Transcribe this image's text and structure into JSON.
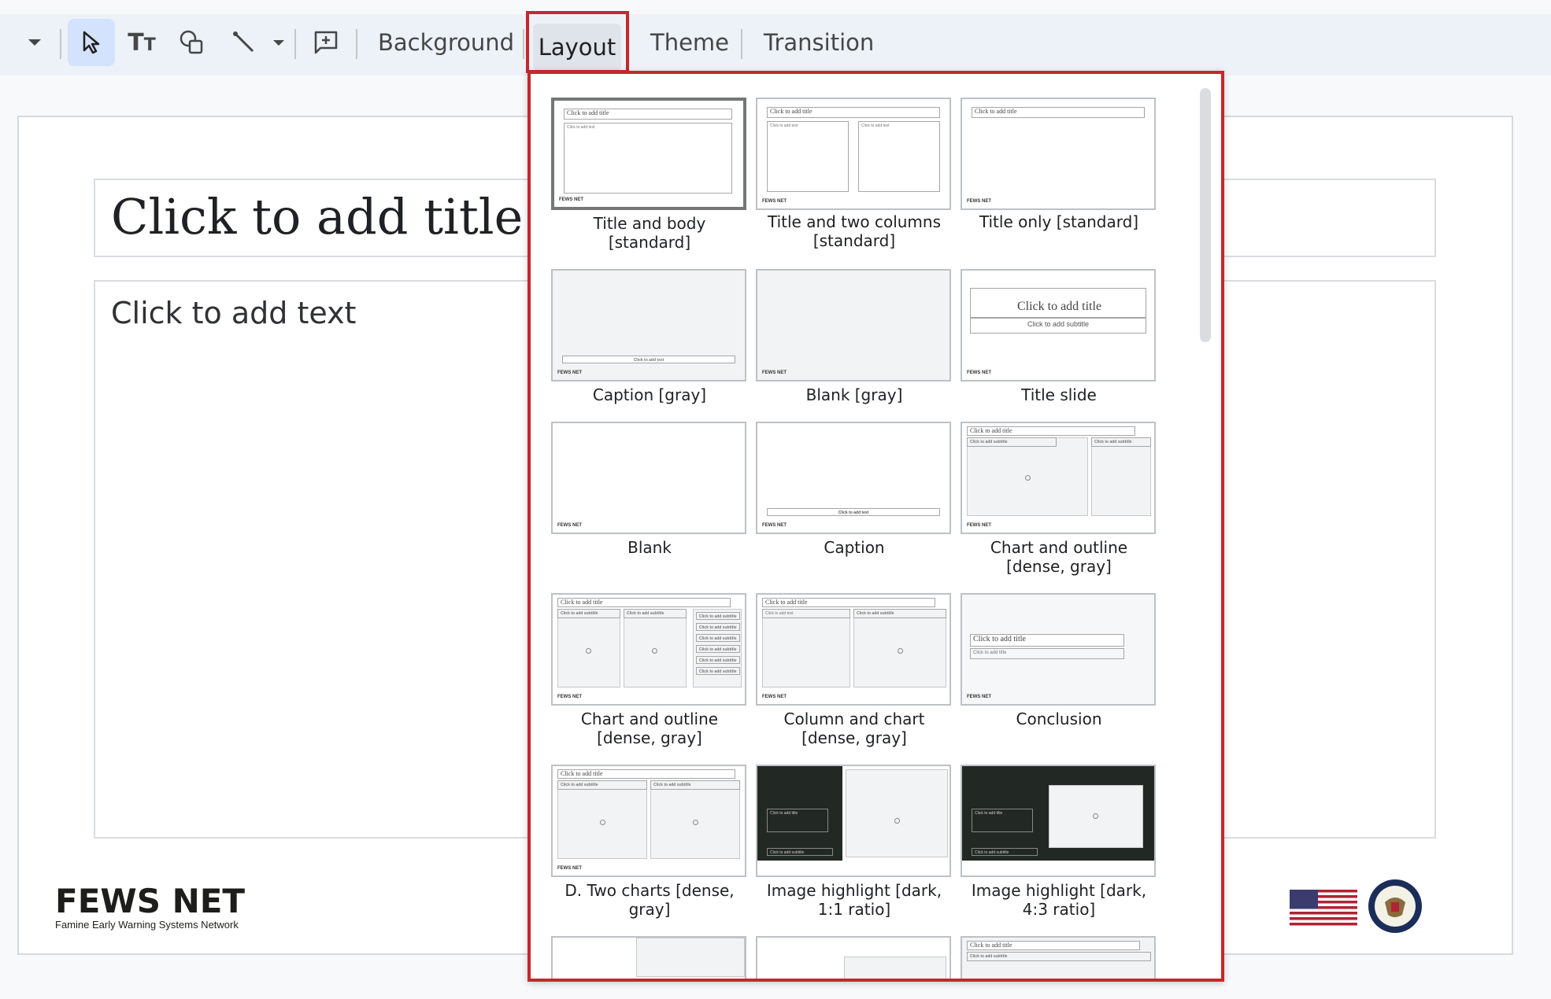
{
  "toolbar": {
    "background_label": "Background",
    "layout_label": "Layout",
    "theme_label": "Theme",
    "transition_label": "Transition"
  },
  "slide": {
    "title_placeholder": "Click to add title",
    "body_placeholder": "Click to add text",
    "logo_main": "FEWS NET",
    "logo_sub": "Famine Early Warning Systems Network"
  },
  "mini": {
    "title": "Click to add title",
    "text": "Click to add text",
    "subtitle": "Click to add subtitle"
  },
  "layouts": [
    {
      "name": "Title and body [standard]",
      "selected": true
    },
    {
      "name": "Title and two columns [standard]"
    },
    {
      "name": "Title only [standard]"
    },
    {
      "name": "Caption [gray]"
    },
    {
      "name": "Blank [gray]"
    },
    {
      "name": "Title slide"
    },
    {
      "name": "Blank"
    },
    {
      "name": "Caption"
    },
    {
      "name": "Chart and outline [dense, gray]"
    },
    {
      "name": "Chart and outline [dense, gray]"
    },
    {
      "name": "Column and chart [dense, gray]"
    },
    {
      "name": "Conclusion"
    },
    {
      "name": "D. Two charts [dense, gray]"
    },
    {
      "name": "Image highlight [dark, 1:1 ratio]"
    },
    {
      "name": "Image highlight [dark, 4:3 ratio]"
    }
  ],
  "colors": {
    "highlight": "#c5282c",
    "selected_bg": "#d3e3fd",
    "toolbar_bg": "#edf1f8"
  }
}
